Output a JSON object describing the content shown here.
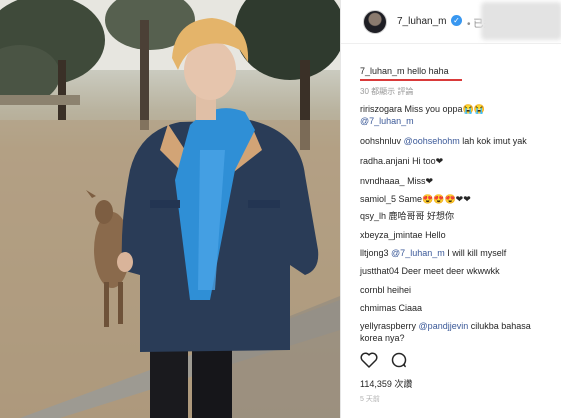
{
  "header": {
    "username": "7_luhan_m",
    "verified_icon": "verified-badge-icon",
    "follow_text": "• 已关"
  },
  "caption": {
    "username": "7_luhan_m",
    "text": "hello haha",
    "translate_text": "30 都顯示 評論"
  },
  "comments": [
    {
      "user": "ririszogara",
      "text": "Miss you oppa😭😭"
    },
    {
      "user": "",
      "mention": "@7_luhan_m",
      "text": ""
    },
    {
      "user": "oohshnluv",
      "mention": "@oohsehohm",
      "text": "lah kok imut yak"
    },
    {
      "user": "radha.anjani",
      "text": "Hi too❤"
    },
    {
      "user": "nvndhaaa_",
      "text": "Miss❤"
    },
    {
      "user": "samiol_5",
      "text": "Same😍😍😍❤❤"
    },
    {
      "user": "qsy_lh",
      "text": "鹿哈哥哥 好想你"
    },
    {
      "user": "xbeyza_jmintae",
      "text": "Hello"
    },
    {
      "user": "lltjong3",
      "mention": "@7_luhan_m",
      "text": "I will kill myself"
    },
    {
      "user": "justthat04",
      "text": "Deer meet deer wkwwkk"
    },
    {
      "user": "cornbl",
      "text": "heihei"
    },
    {
      "user": "chmimas",
      "text": "Ciaaa"
    },
    {
      "user": "yellyraspberry",
      "mention": "@pandjjevin",
      "text": "cilukba bahasa"
    },
    {
      "user": "",
      "text": "korea nya?"
    }
  ],
  "actions": {
    "like_icon": "heart-icon",
    "comment_icon": "comment-bubble-icon"
  },
  "likes_text": "114,359 次讚",
  "date_text": "5 天前",
  "colors": {
    "accent_underline": "#d93a3a",
    "mention": "#3b5998",
    "verified": "#3897f0"
  }
}
